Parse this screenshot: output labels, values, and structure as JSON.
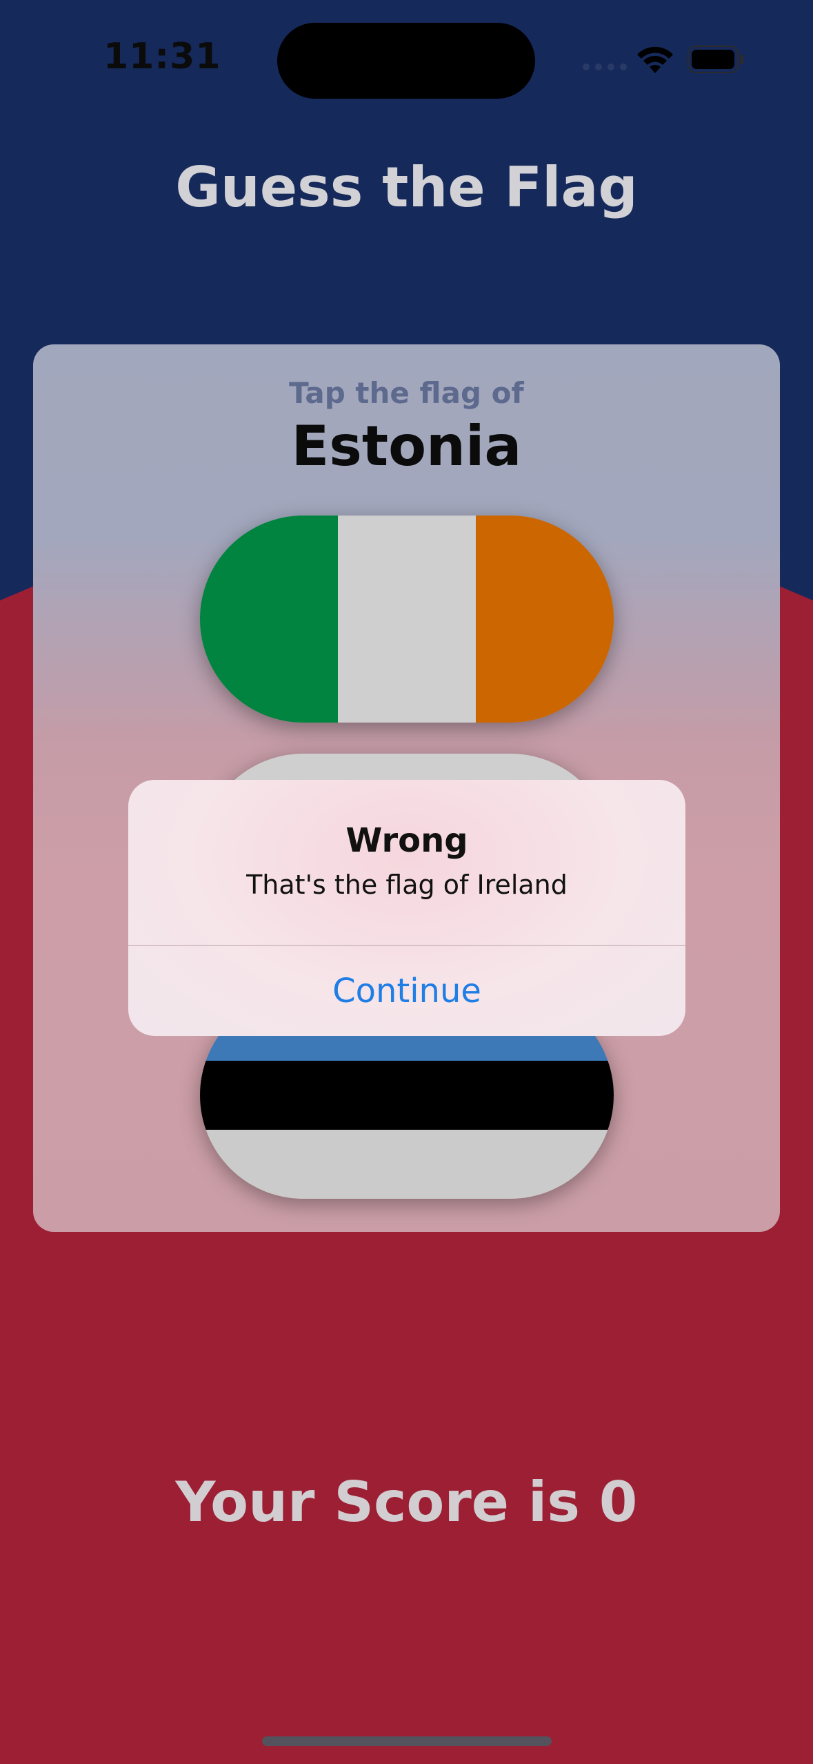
{
  "status_bar": {
    "time": "11:31",
    "icons": [
      "cellular-dots-icon",
      "wifi-icon",
      "battery-icon"
    ]
  },
  "header": {
    "title": "Guess the Flag"
  },
  "card": {
    "prompt": "Tap the flag of",
    "country": "Estonia",
    "flags": [
      {
        "name": "ireland-flag",
        "colors": [
          "#00843f",
          "#cfcfcf",
          "#cc6600"
        ],
        "orientation": "vertical"
      },
      {
        "name": "hidden-flag",
        "colors": [
          "#cfcfcf"
        ]
      },
      {
        "name": "estonia-flag",
        "colors": [
          "#3d78b7",
          "#000000",
          "#cbcbcb"
        ],
        "orientation": "horizontal"
      }
    ]
  },
  "alert": {
    "title": "Wrong",
    "message": "That's the flag of Ireland",
    "button_label": "Continue"
  },
  "footer": {
    "score_text": "Your Score is 0"
  },
  "colors": {
    "top_background": "#16295b",
    "bottom_background": "#9c1f34",
    "alert_button": "#1f7de6"
  }
}
